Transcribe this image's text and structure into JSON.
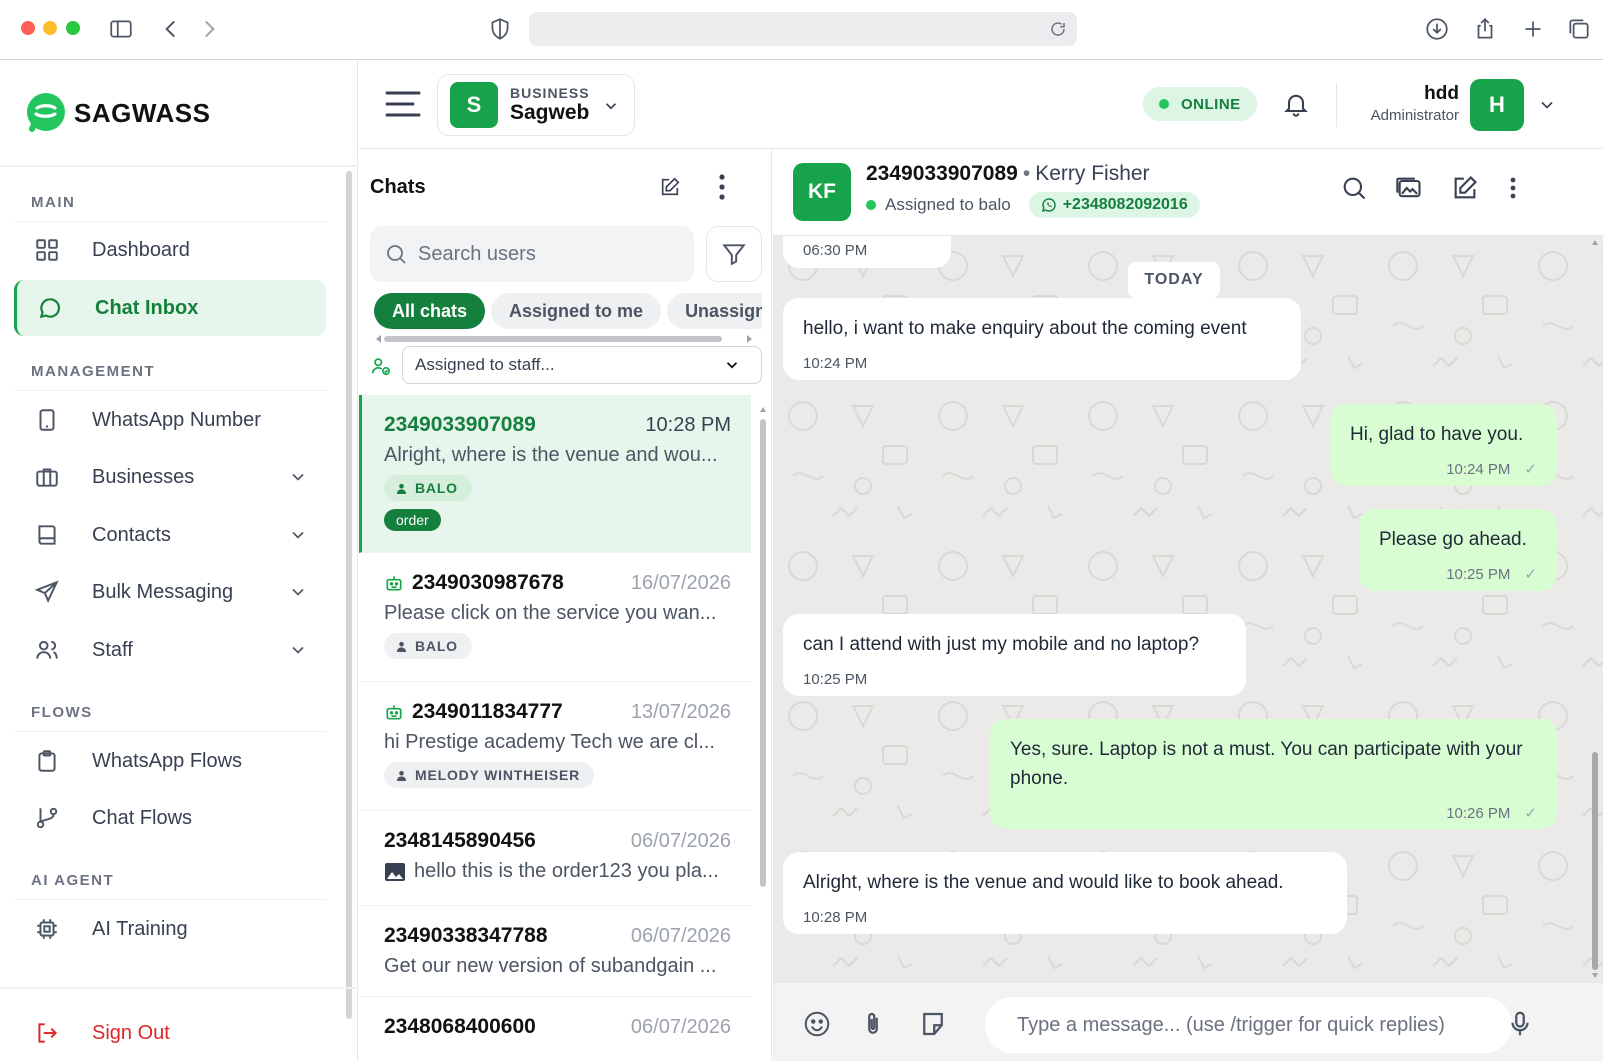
{
  "sidebar": {
    "brand": "SAGWASS",
    "sections": {
      "main": "MAIN",
      "management": "MANAGEMENT",
      "flows": "FLOWS",
      "ai_agent": "AI AGENT"
    },
    "items": {
      "dashboard": "Dashboard",
      "chat_inbox": "Chat Inbox",
      "whatsapp_number": "WhatsApp Number",
      "businesses": "Businesses",
      "contacts": "Contacts",
      "bulk_messaging": "Bulk Messaging",
      "staff": "Staff",
      "whatsapp_flows": "WhatsApp Flows",
      "chat_flows": "Chat Flows",
      "ai_training": "AI Training"
    },
    "sign_out": "Sign Out"
  },
  "header": {
    "business_label": "BUSINESS",
    "business_name": "Sagweb",
    "business_initial": "S",
    "status": "ONLINE",
    "user_name": "hdd",
    "user_role": "Administrator",
    "user_initial": "H"
  },
  "chat_list": {
    "title": "Chats",
    "search_placeholder": "Search users",
    "tabs": [
      "All chats",
      "Assigned to me",
      "Unassigned"
    ],
    "staff_filter": "Assigned to staff...",
    "items": [
      {
        "number": "2349033907089",
        "time": "10:28 PM",
        "preview": "Alright, where is the venue and wou...",
        "badge": "BALO",
        "tag": "order"
      },
      {
        "number": "2349030987678",
        "time": "16/07/2026",
        "preview": "Please click on the service you wan...",
        "badge": "BALO"
      },
      {
        "number": "2349011834777",
        "time": "13/07/2026",
        "preview": "hi Prestige academy Tech we are cl...",
        "badge": "MELODY WINTHEISER"
      },
      {
        "number": "2348145890456",
        "time": "06/07/2026",
        "preview": "hello this is the order123 you pla..."
      },
      {
        "number": "23490338347788",
        "time": "06/07/2026",
        "preview": "Get our new version of subandgain ..."
      },
      {
        "number": "2348068400600",
        "time": "06/07/2026",
        "preview": ""
      }
    ]
  },
  "conversation": {
    "avatar_initials": "KF",
    "number": "2349033907089",
    "separator": "•",
    "contact_name": "Kerry Fisher",
    "assigned": "Assigned to balo",
    "whatsapp": "+2348082092016",
    "day_label": "TODAY",
    "check": "✓",
    "messages": [
      {
        "dir": "in",
        "text": "",
        "time": "06:30 PM"
      },
      {
        "dir": "in",
        "text": "hello, i want to make enquiry about the coming event",
        "time": "10:24 PM"
      },
      {
        "dir": "out",
        "text": "Hi, glad to have you.",
        "time": "10:24 PM"
      },
      {
        "dir": "out",
        "text": "Please go ahead.",
        "time": "10:25 PM"
      },
      {
        "dir": "in",
        "text": "can I attend with just my mobile and no laptop?",
        "time": "10:25 PM"
      },
      {
        "dir": "out",
        "text": "Yes, sure. Laptop is not a must. You can participate with your phone.",
        "time": "10:26 PM"
      },
      {
        "dir": "in",
        "text": "Alright, where is the venue and would like to book ahead.",
        "time": "10:28 PM"
      }
    ]
  },
  "composer": {
    "placeholder": "Type a message... (use /trigger for quick replies)"
  },
  "colors": {
    "brand": "#16a34a",
    "brand_dark": "#15803d",
    "active_bg": "#e7f6ec",
    "outgoing_bubble": "#d9fdd3",
    "danger": "#dc2626"
  }
}
